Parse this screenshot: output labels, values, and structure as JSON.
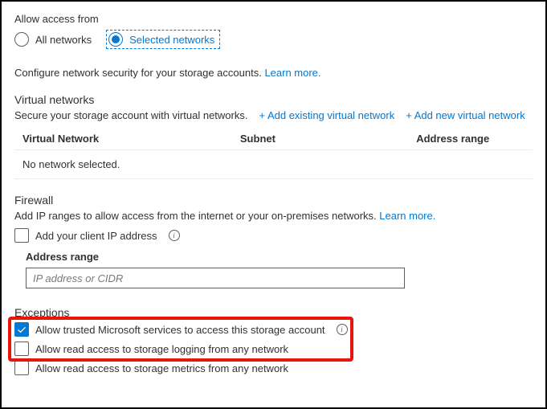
{
  "access": {
    "heading": "Allow access from",
    "opt_all": "All networks",
    "opt_selected": "Selected networks"
  },
  "configure": {
    "text": "Configure network security for your storage accounts.",
    "learn": "Learn more."
  },
  "vnet": {
    "heading": "Virtual networks",
    "desc": "Secure your storage account with virtual networks.",
    "add_existing": "+ Add existing virtual network",
    "add_new": "+ Add new virtual network",
    "col_network": "Virtual Network",
    "col_subnet": "Subnet",
    "col_range": "Address range",
    "empty": "No network selected."
  },
  "firewall": {
    "heading": "Firewall",
    "desc": "Add IP ranges to allow access from the internet or your on-premises networks.",
    "learn": "Learn more.",
    "add_client_ip": "Add your client IP address",
    "addr_label": "Address range",
    "addr_placeholder": "IP address or CIDR"
  },
  "exceptions": {
    "heading": "Exceptions",
    "opt_trusted": "Allow trusted Microsoft services to access this storage account",
    "opt_logging": "Allow read access to storage logging from any network",
    "opt_metrics": "Allow read access to storage metrics from any network"
  }
}
